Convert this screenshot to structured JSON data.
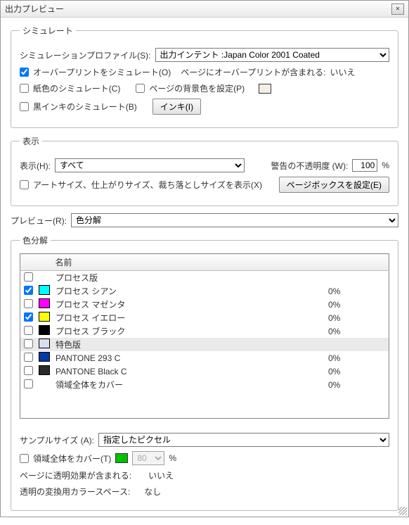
{
  "title": "出力プレビュー",
  "simulate": {
    "legend": "シミュレート",
    "profile_label": "シミュレーションプロファイル(S):",
    "profile_value": "出力インテント :Japan Color 2001 Coated",
    "overprint_label": "オーバープリントをシミュレート(O)",
    "overprint_info_label": "ページにオーバープリントが含まれる:",
    "overprint_info_value": "いいえ",
    "paper_label": "紙色のシミュレート(C)",
    "bgcolor_label": "ページの背景色を設定(P)",
    "blackink_label": "黒インキのシミュレート(B)",
    "ink_button": "インキ(I)"
  },
  "display": {
    "legend": "表示",
    "show_label": "表示(H):",
    "show_value": "すべて",
    "opacity_label": "警告の不透明度 (W):",
    "opacity_value": "100",
    "percent": "%",
    "artsize_label": "アートサイズ、仕上がりサイズ、裁ち落としサイズを表示(X)",
    "pagebox_button": "ページボックスを設定(E)"
  },
  "preview": {
    "label": "プレビュー(R):",
    "value": "色分解"
  },
  "separations": {
    "legend": "色分解",
    "header_name": "名前",
    "rows": [
      {
        "checked": false,
        "color": "",
        "name": "プロセス版",
        "pct": ""
      },
      {
        "checked": true,
        "color": "#00ffff",
        "name": "プロセス シアン",
        "pct": "0%"
      },
      {
        "checked": false,
        "color": "#ff00ff",
        "name": "プロセス マゼンタ",
        "pct": "0%"
      },
      {
        "checked": true,
        "color": "#ffff00",
        "name": "プロセス イエロー",
        "pct": "0%"
      },
      {
        "checked": false,
        "color": "#000000",
        "name": "プロセス ブラック",
        "pct": "0%"
      },
      {
        "checked": false,
        "color": "#d8e0f0",
        "name": "特色版",
        "pct": "",
        "selected": true
      },
      {
        "checked": false,
        "color": "#0039a6",
        "name": "PANTONE 293 C",
        "pct": "0%"
      },
      {
        "checked": false,
        "color": "#2d2926",
        "name": "PANTONE Black C",
        "pct": "0%"
      },
      {
        "checked": false,
        "color": "",
        "name": "領域全体をカバー",
        "pct": "0%"
      }
    ]
  },
  "sample": {
    "label": "サンプルサイズ (A):",
    "value": "指定したピクセル"
  },
  "cover": {
    "label": "領域全体をカバー(T)",
    "color": "#00c000",
    "value": "80",
    "percent": "%"
  },
  "transparency_label": "ページに透明効果が含まれる:",
  "transparency_value": "いいえ",
  "colorspace_label": "透明の変換用カラースペース:",
  "colorspace_value": "なし"
}
